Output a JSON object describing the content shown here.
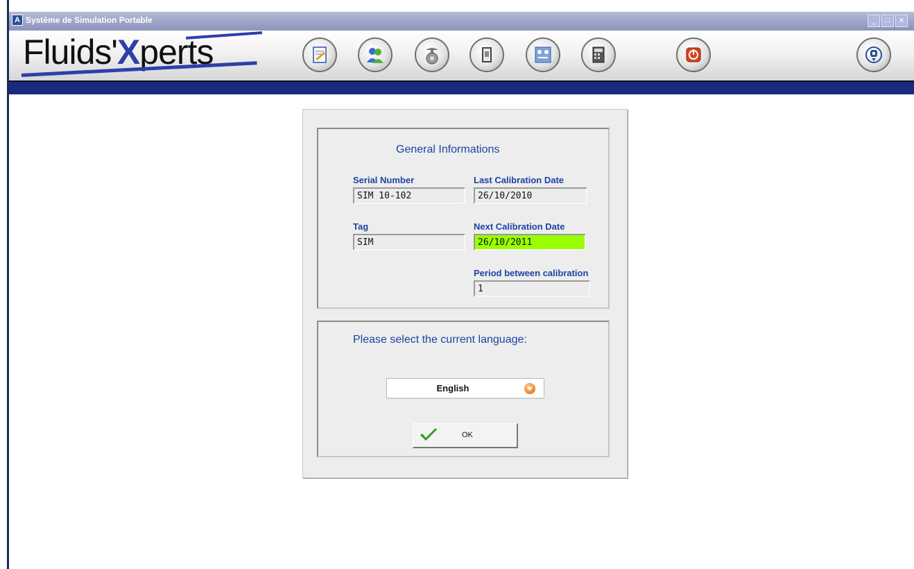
{
  "window": {
    "title": "Système de Simulation Portable",
    "app_icon": "app-logo-icon"
  },
  "brand": {
    "logo_part1": "Fluids'",
    "logo_x": "X",
    "logo_part2": "perts",
    "accent_color": "#2d3fa8",
    "band_color": "#1a2a7c"
  },
  "toolbar": {
    "icons": [
      "notepad-icon",
      "users-icon",
      "scale-icon",
      "device-icon",
      "network-icon",
      "calculator-icon",
      "power-icon",
      "about-icon"
    ]
  },
  "general": {
    "title": "General Informations",
    "serial_label": "Serial Number",
    "serial_value": "SIM 10-102",
    "last_cal_label": "Last Calibration Date",
    "last_cal_value": "26/10/2010",
    "tag_label": "Tag",
    "tag_value": "SIM",
    "next_cal_label": "Next Calibration Date",
    "next_cal_value": "26/10/2011",
    "next_cal_color": "#99ff00",
    "period_label": "Period between calibration",
    "period_value": "1"
  },
  "language": {
    "prompt": "Please select the current language:",
    "selected": "English",
    "ok_label": "OK"
  }
}
